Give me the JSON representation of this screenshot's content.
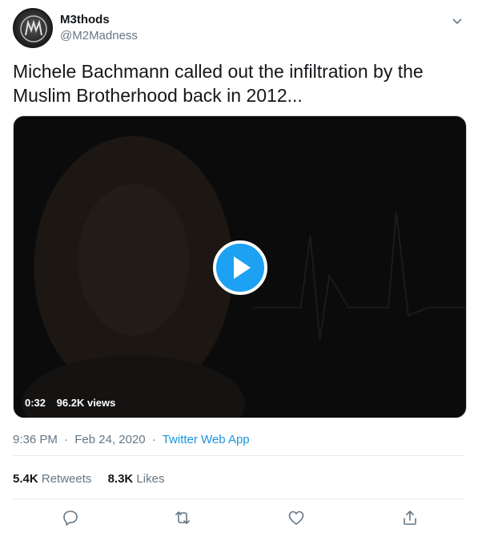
{
  "user": {
    "display_name": "M3thods",
    "handle": "@M2Madness"
  },
  "tweet": {
    "text": "Michele Bachmann called out the infiltration by the Muslim Brotherhood back in 2012..."
  },
  "video": {
    "duration": "0:32",
    "views": "96.2K views"
  },
  "meta": {
    "time": "9:36 PM",
    "separator_1": "·",
    "date": "Feb 24, 2020",
    "separator_2": "·",
    "source": "Twitter Web App"
  },
  "stats": {
    "retweets_count": "5.4K",
    "retweets_label": "Retweets",
    "likes_count": "8.3K",
    "likes_label": "Likes"
  },
  "icons": {
    "reply": "reply-icon",
    "retweet": "retweet-icon",
    "like": "heart-icon",
    "share": "share-icon",
    "caret": "chevron-down-icon",
    "play": "play-icon"
  },
  "colors": {
    "accent": "#1da1f2",
    "link": "#1b95e0",
    "secondary_text": "#657786"
  }
}
